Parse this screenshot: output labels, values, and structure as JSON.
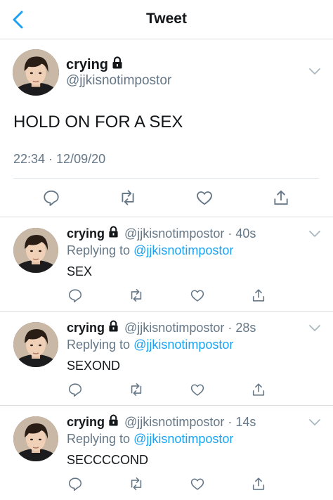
{
  "header": {
    "title": "Tweet",
    "back_icon": "chevron-left-icon",
    "accent": "#1da1f2"
  },
  "main_tweet": {
    "display_name": "crying",
    "handle": "@jjkisnotimpostor",
    "text": "HOLD ON FOR A SEX",
    "timestamp": "22:34 · 12/09/20",
    "actions": [
      "reply-icon",
      "retweet-icon",
      "like-icon",
      "share-icon"
    ]
  },
  "replies": [
    {
      "display_name": "crying",
      "handle_time": "@jjkisnotimpostor · 40s",
      "replying_label": "Replying to",
      "replying_to": "@jjkisnotimpostor",
      "text": "SEX"
    },
    {
      "display_name": "crying",
      "handle_time": "@jjkisnotimpostor · 28s",
      "replying_label": "Replying to",
      "replying_to": "@jjkisnotimpostor",
      "text": "SEXOND"
    },
    {
      "display_name": "crying",
      "handle_time": "@jjkisnotimpostor · 14s",
      "replying_label": "Replying to",
      "replying_to": "@jjkisnotimpostor",
      "text": "SECCCCOND"
    }
  ]
}
